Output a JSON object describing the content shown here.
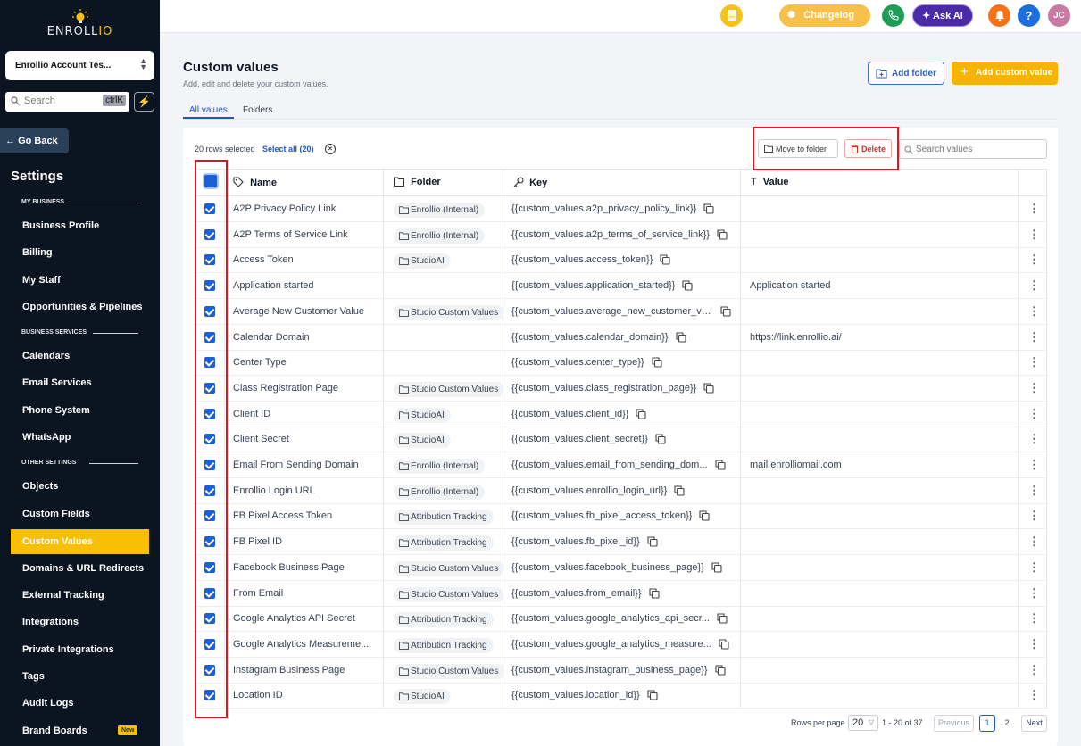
{
  "brand": {
    "logo_prefix": "ENROLL",
    "logo_suffix": "IO"
  },
  "sidebar": {
    "account": "Enrollio Account Tes...",
    "search_placeholder": "Search",
    "search_shortcut": "ctrlK",
    "go_back": "Go Back",
    "settings_title": "Settings",
    "sections": [
      {
        "label": "MY BUSINESS"
      },
      {
        "label": "BUSINESS SERVICES"
      },
      {
        "label": "OTHER SETTINGS"
      }
    ],
    "items": [
      {
        "label": "Business Profile"
      },
      {
        "label": "Billing"
      },
      {
        "label": "My Staff"
      },
      {
        "label": "Opportunities & Pipelines"
      },
      {
        "label": "Calendars"
      },
      {
        "label": "Email Services"
      },
      {
        "label": "Phone System"
      },
      {
        "label": "WhatsApp"
      },
      {
        "label": "Objects"
      },
      {
        "label": "Custom Fields"
      },
      {
        "label": "Custom Values"
      },
      {
        "label": "Domains & URL Redirects"
      },
      {
        "label": "External Tracking"
      },
      {
        "label": "Integrations"
      },
      {
        "label": "Private Integrations"
      },
      {
        "label": "Tags"
      },
      {
        "label": "Audit Logs"
      },
      {
        "label": "Brand Boards",
        "badge": "New"
      }
    ],
    "active_item": "Custom Values"
  },
  "topbar": {
    "changelog": "Changelog",
    "ask_ai": "Ask AI",
    "help": "?",
    "avatar_initials": "JC",
    "colors": {
      "note": "#f7c21b",
      "changelog": "#f6c04a",
      "phone": "#1f9d55",
      "ask_ai": "#4b2aa8",
      "bell": "#f97316",
      "help": "#1d6fe0",
      "avatar": "#c97aa3"
    }
  },
  "page": {
    "title": "Custom values",
    "subtitle": "Add, edit and delete your custom values.",
    "add_folder": "Add folder",
    "add_custom_value": "Add custom value",
    "tabs": [
      "All values",
      "Folders"
    ],
    "active_tab": "All values"
  },
  "selection": {
    "rows_selected": "20 rows selected",
    "select_all": "Select all (20)",
    "move_to_folder": "Move to folder",
    "delete": "Delete",
    "search_placeholder": "Search values"
  },
  "table": {
    "columns": {
      "name": "Name",
      "folder": "Folder",
      "key": "Key",
      "value": "Value"
    },
    "rows": [
      {
        "name": "A2P Privacy Policy Link",
        "folder": "Enrollio (Internal)",
        "key": "{{custom_values.a2p_privacy_policy_link}}",
        "value": ""
      },
      {
        "name": "A2P Terms of Service Link",
        "folder": "Enrollio (Internal)",
        "key": "{{custom_values.a2p_terms_of_service_link}}",
        "value": ""
      },
      {
        "name": "Access Token",
        "folder": "StudioAI",
        "key": "{{custom_values.access_token}}",
        "value": ""
      },
      {
        "name": "Application started",
        "folder": "",
        "key": "{{custom_values.application_started}}",
        "value": "Application started"
      },
      {
        "name": "Average New Customer Value",
        "folder": "Studio Custom Values",
        "key": "{{custom_values.average_new_customer_va...",
        "value": ""
      },
      {
        "name": "Calendar Domain",
        "folder": "",
        "key": "{{custom_values.calendar_domain}}",
        "value": "https://link.enrollio.ai/"
      },
      {
        "name": "Center Type",
        "folder": "",
        "key": "{{custom_values.center_type}}",
        "value": ""
      },
      {
        "name": "Class Registration Page",
        "folder": "Studio Custom Values",
        "key": "{{custom_values.class_registration_page}}",
        "value": ""
      },
      {
        "name": "Client ID",
        "folder": "StudioAI",
        "key": "{{custom_values.client_id}}",
        "value": ""
      },
      {
        "name": "Client Secret",
        "folder": "StudioAI",
        "key": "{{custom_values.client_secret}}",
        "value": ""
      },
      {
        "name": "Email From Sending Domain",
        "folder": "Enrollio (Internal)",
        "key": "{{custom_values.email_from_sending_dom...",
        "value": "mail.enrolliomail.com"
      },
      {
        "name": "Enrollio Login URL",
        "folder": "Enrollio (Internal)",
        "key": "{{custom_values.enrollio_login_url}}",
        "value": ""
      },
      {
        "name": "FB Pixel Access Token",
        "folder": "Attribution Tracking",
        "key": "{{custom_values.fb_pixel_access_token}}",
        "value": ""
      },
      {
        "name": "FB Pixel ID",
        "folder": "Attribution Tracking",
        "key": "{{custom_values.fb_pixel_id}}",
        "value": ""
      },
      {
        "name": "Facebook Business Page",
        "folder": "Studio Custom Values",
        "key": "{{custom_values.facebook_business_page}}",
        "value": ""
      },
      {
        "name": "From Email",
        "folder": "Studio Custom Values",
        "key": "{{custom_values.from_email}}",
        "value": ""
      },
      {
        "name": "Google Analytics API Secret",
        "folder": "Attribution Tracking",
        "key": "{{custom_values.google_analytics_api_secr...",
        "value": ""
      },
      {
        "name": "Google Analytics Measureme...",
        "folder": "Attribution Tracking",
        "key": "{{custom_values.google_analytics_measure...",
        "value": ""
      },
      {
        "name": "Instagram Business Page",
        "folder": "Studio Custom Values",
        "key": "{{custom_values.instagram_business_page}}",
        "value": ""
      },
      {
        "name": "Location ID",
        "folder": "StudioAI",
        "key": "{{custom_values.location_id}}",
        "value": ""
      }
    ]
  },
  "pagination": {
    "rows_per_page_label": "Rows per page",
    "rows_per_page": "20",
    "range": "1 - 20 of 37",
    "previous": "Previous",
    "pages": [
      "1",
      "2"
    ],
    "current_page": "1",
    "next": "Next"
  }
}
